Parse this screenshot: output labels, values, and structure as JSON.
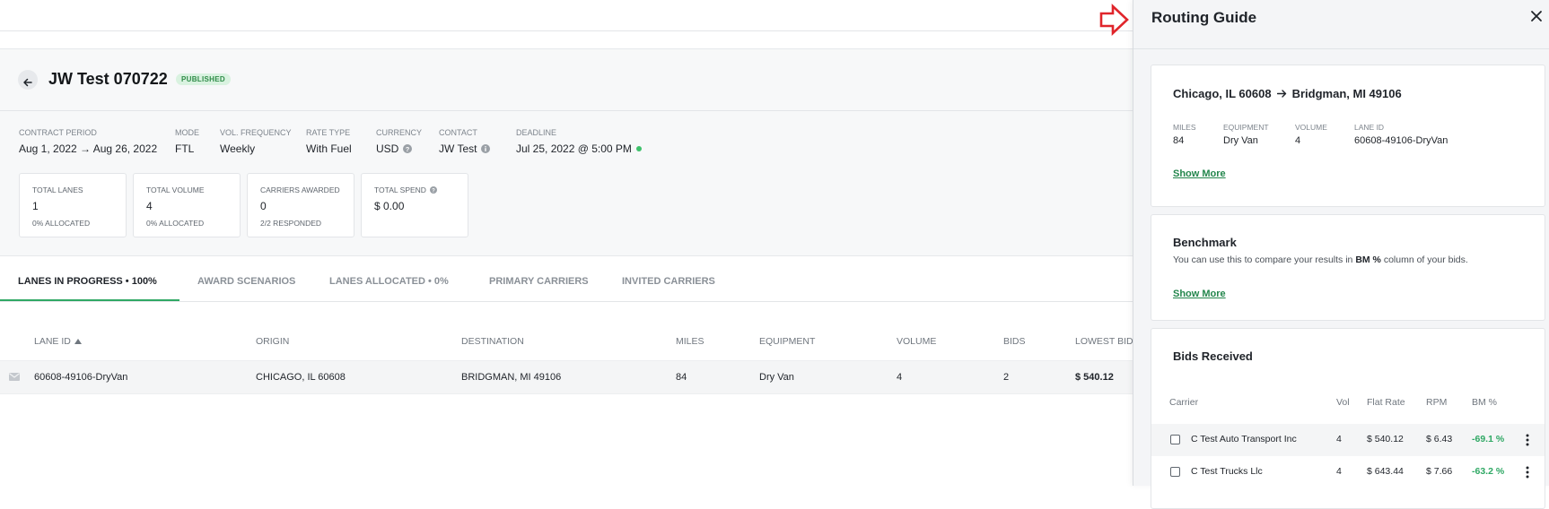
{
  "contract": {
    "title": "JW Test 070722",
    "status": "PUBLISHED",
    "meta": [
      {
        "label": "CONTRACT PERIOD",
        "value": "Aug 1, 2022 → Aug 26, 2022"
      },
      {
        "label": "MODE",
        "value": "FTL"
      },
      {
        "label": "VOL. FREQUENCY",
        "value": "Weekly"
      },
      {
        "label": "RATE TYPE",
        "value": "With Fuel"
      },
      {
        "label": "CURRENCY",
        "value": "USD"
      },
      {
        "label": "CONTACT",
        "value": "JW Test"
      },
      {
        "label": "DEADLINE",
        "value": "Jul 25, 2022 @ 5:00 PM"
      }
    ],
    "stats": [
      {
        "label": "TOTAL LANES",
        "value": "1",
        "sub": "0% ALLOCATED"
      },
      {
        "label": "TOTAL VOLUME",
        "value": "4",
        "sub": "0% ALLOCATED"
      },
      {
        "label": "CARRIERS AWARDED",
        "value": "0",
        "sub": "2/2 RESPONDED"
      },
      {
        "label": "TOTAL SPEND",
        "value": "$ 0.00",
        "sub": ""
      }
    ]
  },
  "tabs": [
    {
      "label": "LANES IN PROGRESS  •  100%"
    },
    {
      "label": "AWARD SCENARIOS"
    },
    {
      "label": "LANES ALLOCATED  •  0%"
    },
    {
      "label": "PRIMARY CARRIERS"
    },
    {
      "label": "INVITED CARRIERS"
    }
  ],
  "table": {
    "headers": [
      "LANE ID",
      "ORIGIN",
      "DESTINATION",
      "MILES",
      "EQUIPMENT",
      "VOLUME",
      "BIDS",
      "LOWEST BID"
    ],
    "rows": [
      {
        "lane_id": "60608-49106-DryVan",
        "origin": "CHICAGO, IL 60608",
        "destination": "BRIDGMAN, MI 49106",
        "miles": "84",
        "equipment": "Dry Van",
        "volume": "4",
        "bids": "2",
        "lowest_bid": "$ 540.12"
      }
    ]
  },
  "panel": {
    "title": "Routing Guide",
    "route": {
      "origin": "Chicago, IL 60608",
      "destination": "Bridgman, MI 49106",
      "meta": [
        {
          "label": "MILES",
          "value": "84"
        },
        {
          "label": "EQUIPMENT",
          "value": "Dry Van"
        },
        {
          "label": "VOLUME",
          "value": "4"
        },
        {
          "label": "LANE ID",
          "value": "60608-49106-DryVan"
        }
      ],
      "show_more": "Show More"
    },
    "benchmark": {
      "title": "Benchmark",
      "desc_before": "You can use this to compare your results in ",
      "desc_bold": "BM %",
      "desc_after": " column of your bids.",
      "show_more": "Show More"
    },
    "bids": {
      "title": "Bids Received",
      "headers": {
        "carrier": "Carrier",
        "vol": "Vol",
        "flat_rate": "Flat Rate",
        "rpm": "RPM",
        "bm": "BM %"
      },
      "rows": [
        {
          "carrier": "C Test Auto Transport Inc",
          "vol": "4",
          "flat_rate": "$ 540.12",
          "rpm": "$ 6.43",
          "bm": "-69.1 %"
        },
        {
          "carrier": "C Test Trucks Llc",
          "vol": "4",
          "flat_rate": "$ 643.44",
          "rpm": "$ 7.66",
          "bm": "-63.2 %"
        }
      ]
    }
  },
  "colors": {
    "accent": "#2fa864",
    "badge_bg": "#d9f2e0",
    "arrow": "#e0252b"
  }
}
